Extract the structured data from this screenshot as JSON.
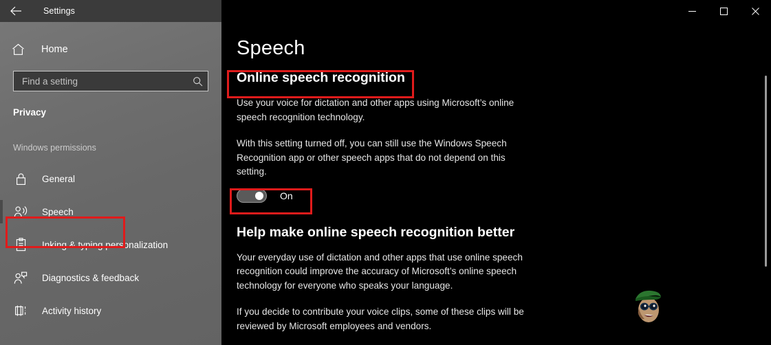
{
  "window": {
    "title": "Settings",
    "back_icon": "back-arrow-icon",
    "controls": {
      "minimize": "minimize-icon",
      "maximize": "maximize-icon",
      "close": "close-icon"
    }
  },
  "sidebar": {
    "home": {
      "label": "Home",
      "icon": "home-icon"
    },
    "search": {
      "placeholder": "Find a setting",
      "value": "",
      "icon": "search-icon"
    },
    "section_title": "Privacy",
    "group_header": "Windows permissions",
    "items": [
      {
        "label": "General",
        "icon": "lock-icon",
        "selected": false
      },
      {
        "label": "Speech",
        "icon": "speech-person-icon",
        "selected": true
      },
      {
        "label": "Inking & typing personalization",
        "icon": "clipboard-icon",
        "selected": false
      },
      {
        "label": "Diagnostics & feedback",
        "icon": "person-feedback-icon",
        "selected": false
      },
      {
        "label": "Activity history",
        "icon": "activity-history-icon",
        "selected": false
      }
    ]
  },
  "main": {
    "page_title": "Speech",
    "section_heading": "Online speech recognition",
    "paragraph_1": "Use your voice for dictation and other apps using Microsoft’s online speech recognition technology.",
    "paragraph_2": "With this setting turned off, you can still use the Windows Speech Recognition app or other speech apps that do not depend on this setting.",
    "toggle": {
      "state_label": "On",
      "checked": true
    },
    "subsection_heading": "Help make online speech recognition better",
    "paragraph_3": "Your everyday use of dictation and other apps that use online speech recognition could improve the accuracy of Microsoft’s online speech technology for everyone who speaks your language.",
    "paragraph_4": "If you decide to contribute your voice clips, some of these clips will be reviewed by Microsoft employees and vendors."
  },
  "annotations": {
    "highlight_color": "#e01b1b",
    "boxes": [
      {
        "name": "heading-highlight",
        "target": "Online speech recognition"
      },
      {
        "name": "toggle-highlight",
        "target": "On"
      },
      {
        "name": "sidebar-speech-highlight",
        "target": "Speech"
      }
    ]
  },
  "scrollbar": {
    "orientation": "vertical",
    "thumb_position_percent": 17
  },
  "watermark": {
    "name": "site-mascot-watermark"
  },
  "colors": {
    "sidebar_bg": "#6e6e6e",
    "content_bg": "#000000",
    "titlebar_bg": "#3b3b3b",
    "text_primary": "#ffffff",
    "toggle_track": "#5a5a5a"
  }
}
